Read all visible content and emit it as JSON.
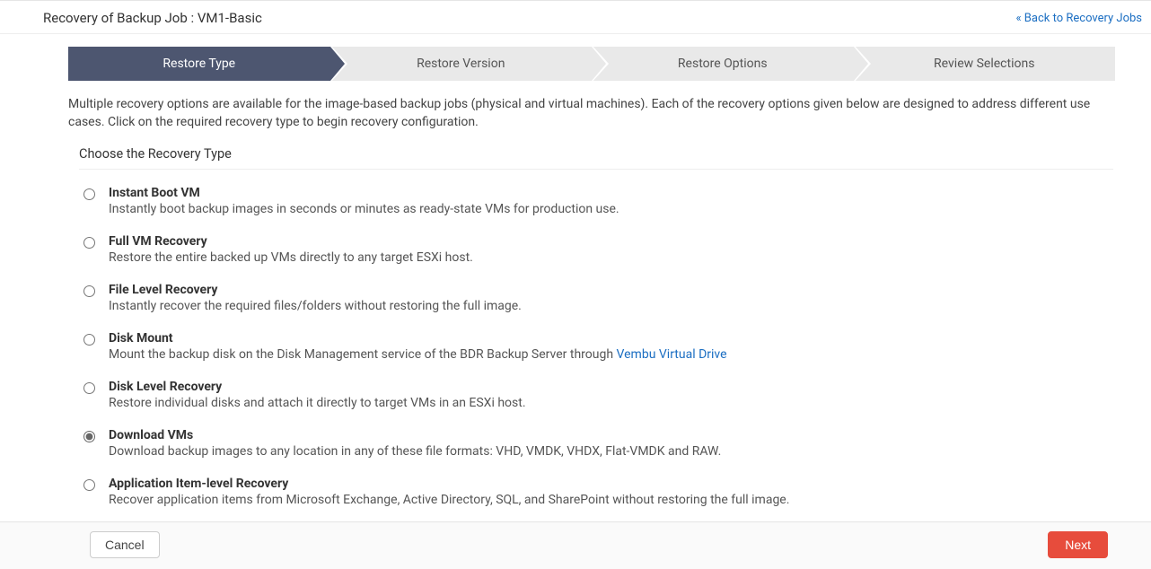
{
  "header": {
    "title_prefix": "Recovery of Backup Job  : ",
    "job_name": "VM1-Basic",
    "back_link": "« Back to Recovery Jobs"
  },
  "wizard": {
    "steps": [
      {
        "label": "Restore Type",
        "active": true
      },
      {
        "label": "Restore Version",
        "active": false
      },
      {
        "label": "Restore Options",
        "active": false
      },
      {
        "label": "Review Selections",
        "active": false
      }
    ]
  },
  "intro_text": "Multiple recovery options are available for the image-based backup jobs (physical and virtual machines). Each of the recovery options given below are designed to address different use cases. Click on the required recovery type to begin recovery configuration.",
  "choose_label": "Choose the Recovery Type",
  "options": [
    {
      "id": "instant-boot-vm",
      "title": "Instant Boot VM",
      "desc": "Instantly boot backup images in seconds or minutes as ready-state VMs for production use.",
      "selected": false
    },
    {
      "id": "full-vm-recovery",
      "title": "Full VM Recovery",
      "desc": "Restore the entire backed up VMs directly to any target ESXi host.",
      "selected": false
    },
    {
      "id": "file-level-recovery",
      "title": "File Level Recovery",
      "desc": "Instantly recover the required files/folders without restoring the full image.",
      "selected": false
    },
    {
      "id": "disk-mount",
      "title": "Disk Mount",
      "desc_pre": "Mount the backup disk on the Disk Management service of the BDR Backup Server through ",
      "link_text": "Vembu Virtual Drive",
      "selected": false
    },
    {
      "id": "disk-level-recovery",
      "title": "Disk Level Recovery",
      "desc": "Restore individual disks and attach it directly to target VMs in an ESXi host.",
      "selected": false
    },
    {
      "id": "download-vms",
      "title": "Download VMs",
      "desc": "Download backup images to any location in any of these file formats: VHD, VMDK, VHDX, Flat-VMDK and RAW.",
      "selected": true
    },
    {
      "id": "application-item-level-recovery",
      "title": "Application Item-level Recovery",
      "desc": "Recover application items from Microsoft Exchange, Active Directory, SQL, and SharePoint without restoring the full image.",
      "selected": false
    }
  ],
  "footer": {
    "cancel_label": "Cancel",
    "next_label": "Next"
  }
}
